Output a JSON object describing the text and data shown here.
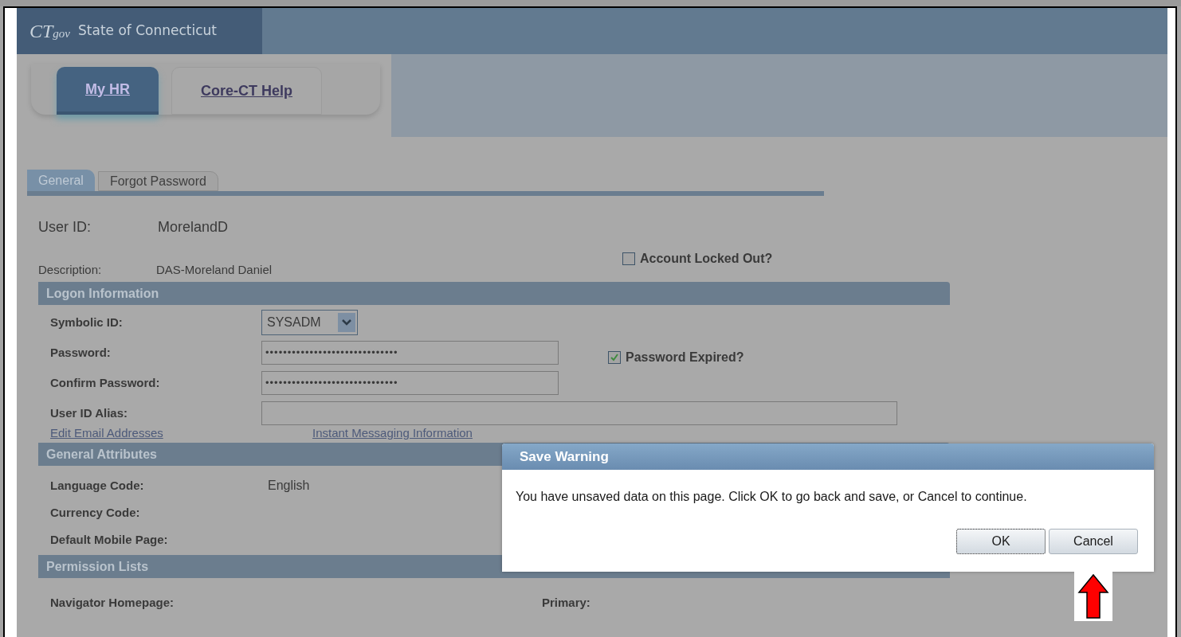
{
  "header": {
    "logo": {
      "main": "CT",
      "suffix": "gov"
    },
    "site_title": "State of Connecticut"
  },
  "nav_tabs": [
    {
      "label": "My HR",
      "selected": true
    },
    {
      "label": "Core-CT Help",
      "selected": false
    }
  ],
  "page_tabs": [
    {
      "label": "General",
      "selected": true
    },
    {
      "label": "Forgot Password",
      "selected": false
    }
  ],
  "user_id": {
    "label": "User ID:",
    "value": "MorelandD"
  },
  "description": {
    "label": "Description:",
    "value": "DAS-Moreland Daniel"
  },
  "account_locked": {
    "label": "Account Locked Out?",
    "checked": false
  },
  "logon": {
    "title": "Logon Information",
    "symbolic_id": {
      "label": "Symbolic ID:",
      "value": "SYSADM"
    },
    "password": {
      "label": "Password:",
      "value": "••••••••••••••••••••••••••••••"
    },
    "password_expired": {
      "label": "Password Expired?",
      "checked": true
    },
    "confirm_password": {
      "label": "Confirm Password:",
      "value": "••••••••••••••••••••••••••••••"
    },
    "alias": {
      "label": "User ID Alias:"
    },
    "links": [
      "Edit Email Addresses",
      "Instant Messaging Information"
    ]
  },
  "general_attributes": {
    "title": "General Attributes",
    "rows": [
      {
        "label": "Language Code:",
        "value": "English"
      },
      {
        "label": "Currency Code:"
      },
      {
        "label": "Default Mobile Page:"
      }
    ]
  },
  "permission_lists": {
    "title": "Permission Lists",
    "navigator_label": "Navigator Homepage:",
    "primary_label": "Primary:"
  },
  "dialog": {
    "title": "Save Warning",
    "message": "You have unsaved data on this page. Click OK to go back and save, or Cancel to continue.",
    "buttons": [
      {
        "label": "OK",
        "focused": true
      },
      {
        "label": "Cancel",
        "focused": false
      }
    ]
  }
}
